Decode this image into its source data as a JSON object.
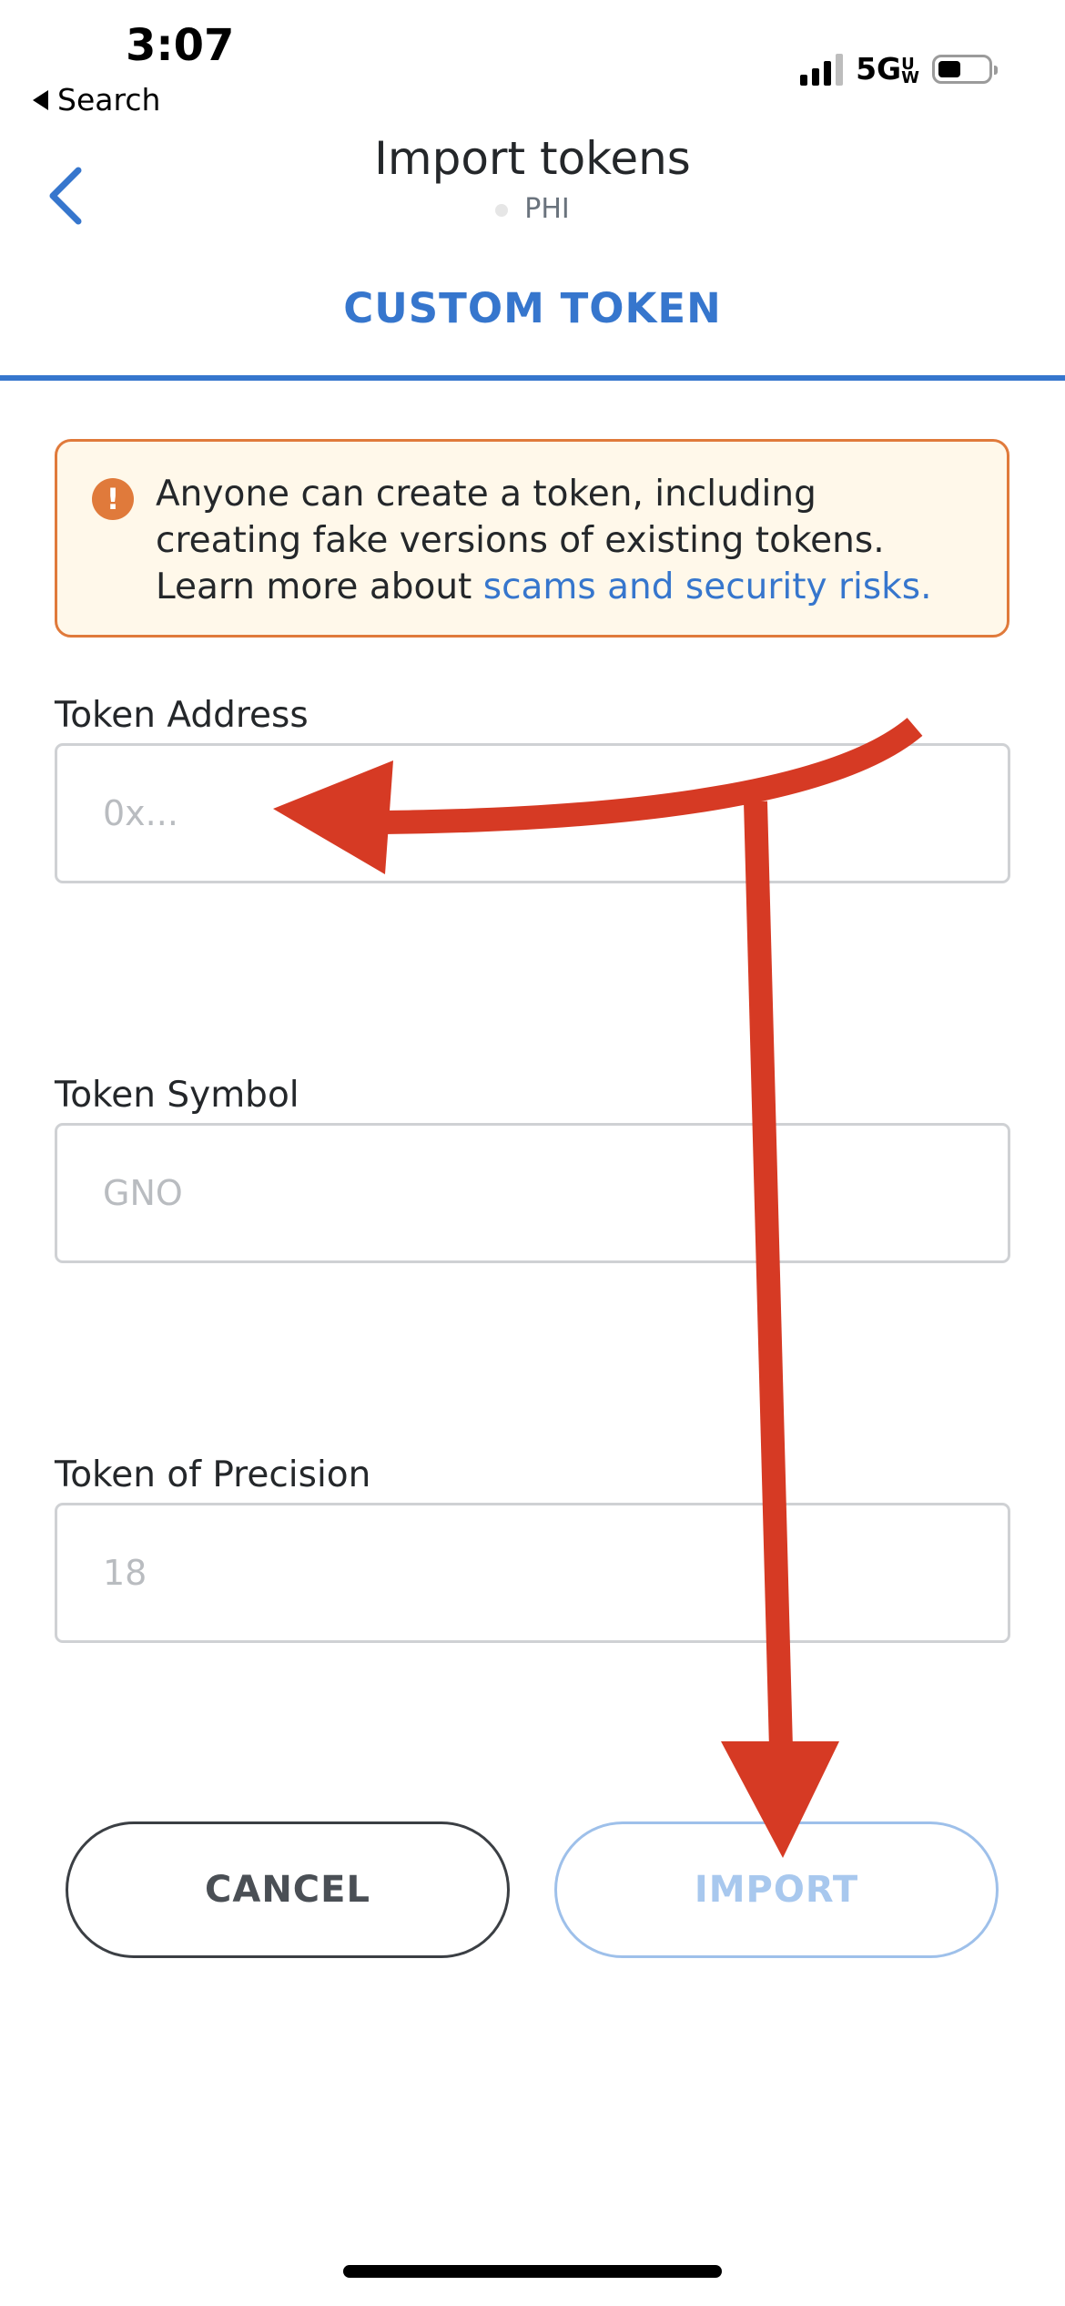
{
  "status_bar": {
    "time": "3:07",
    "back_app": "Search",
    "network": "5GUW",
    "icons": [
      "cellular-signal-icon",
      "battery-icon"
    ]
  },
  "header": {
    "title": "Import tokens",
    "network_name": "PHI",
    "back_icon": "chevron-left-icon"
  },
  "tabs": [
    {
      "label": "CUSTOM TOKEN",
      "active": true
    }
  ],
  "warning": {
    "icon": "exclamation-circle-icon",
    "text": "Anyone can create a token, including creating fake versions of existing tokens. Learn more about",
    "link_text": "scams and security risks."
  },
  "form": {
    "address": {
      "label": "Token Address",
      "placeholder": "0x..."
    },
    "symbol": {
      "label": "Token Symbol",
      "placeholder": "GNO"
    },
    "precision": {
      "label": "Token of Precision",
      "placeholder": "18"
    }
  },
  "actions": {
    "cancel_label": "CANCEL",
    "import_label": "IMPORT"
  },
  "colors": {
    "accent": "#3676cd",
    "warning_border": "#e07a3b",
    "warning_bg": "#fff8ea",
    "annotation_arrow": "#d63a24"
  }
}
